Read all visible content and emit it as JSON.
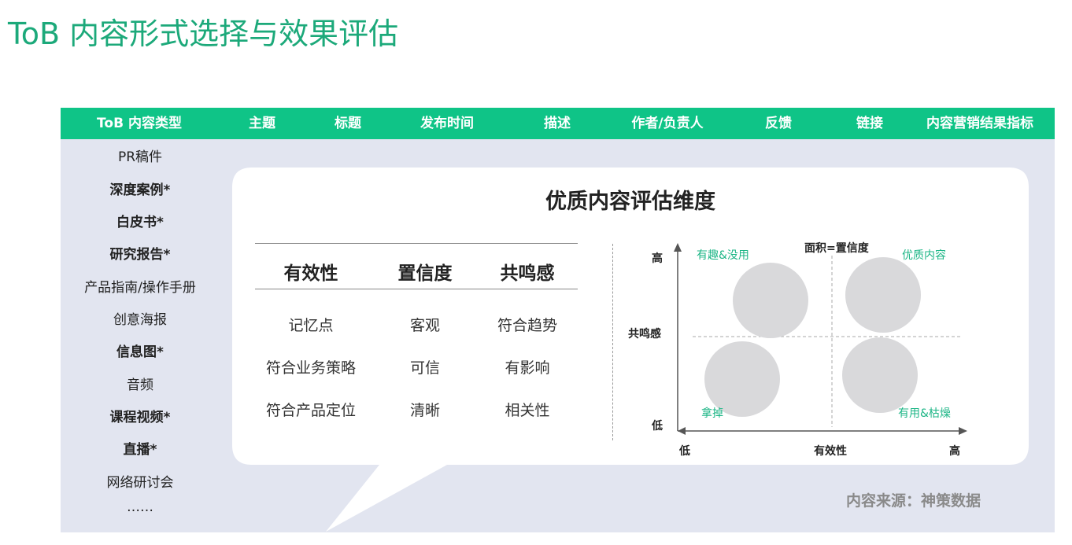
{
  "page_title": "ToB 内容形式选择与效果评估",
  "header": {
    "columns": [
      "ToB 内容类型",
      "主题",
      "标题",
      "发布时间",
      "描述",
      "作者/负责人",
      "反馈",
      "链接",
      "内容营销结果指标"
    ]
  },
  "content_types": [
    {
      "label": "PR稿件",
      "bold": false
    },
    {
      "label": "深度案例*",
      "bold": true
    },
    {
      "label": "白皮书*",
      "bold": true
    },
    {
      "label": "研究报告*",
      "bold": true
    },
    {
      "label": "产品指南/操作手册",
      "bold": false
    },
    {
      "label": "创意海报",
      "bold": false
    },
    {
      "label": "信息图*",
      "bold": true
    },
    {
      "label": "音频",
      "bold": false
    },
    {
      "label": "课程视频*",
      "bold": true
    },
    {
      "label": "直播*",
      "bold": true
    },
    {
      "label": "网络研讨会",
      "bold": false
    },
    {
      "label": "……",
      "bold": false
    }
  ],
  "evaluation": {
    "title": "优质内容评估维度",
    "table": {
      "headers": [
        "有效性",
        "置信度",
        "共鸣感"
      ],
      "rows": [
        [
          "记忆点",
          "客观",
          "符合趋势"
        ],
        [
          "符合业务策略",
          "可信",
          "有影响"
        ],
        [
          "符合产品定位",
          "清晰",
          "相关性"
        ]
      ]
    },
    "quadrant": {
      "note": "面积=置信度",
      "y_axis": {
        "label": "共鸣感",
        "high": "高",
        "low": "低"
      },
      "x_axis": {
        "label": "有效性",
        "low": "低",
        "high": "高"
      },
      "quadrants": {
        "top_left": "有趣&没用",
        "top_right": "优质内容",
        "bottom_left": "拿掉",
        "bottom_right": "有用&枯燥"
      },
      "bubble_color": "#d9d9db",
      "label_color": "#1bb585"
    }
  },
  "source": "内容来源：神策数据",
  "colors": {
    "accent": "#0fc487",
    "title": "#1ca97a",
    "panel_bg": "#e2e5f0"
  }
}
